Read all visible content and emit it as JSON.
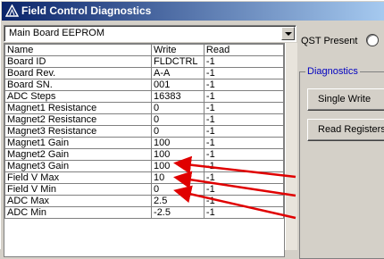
{
  "window": {
    "title": "Field Control Diagnostics"
  },
  "selector": {
    "value": "Main Board EEPROM"
  },
  "table": {
    "headers": [
      "Name",
      "Write",
      "Read"
    ],
    "rows": [
      [
        "Board ID",
        "FLDCTRL",
        "-1"
      ],
      [
        "Board Rev.",
        "A-A",
        "-1"
      ],
      [
        "Board SN.",
        "001",
        "-1"
      ],
      [
        "ADC Steps",
        "16383",
        "-1"
      ],
      [
        "Magnet1 Resistance",
        "0",
        "-1"
      ],
      [
        "Magnet2 Resistance",
        "0",
        "-1"
      ],
      [
        "Magnet3 Resistance",
        "0",
        "-1"
      ],
      [
        "Magnet1 Gain",
        "100",
        "-1"
      ],
      [
        "Magnet2 Gain",
        "100",
        "-1"
      ],
      [
        "Magnet3 Gain",
        "100",
        "-1"
      ],
      [
        "Field V Max",
        "10",
        "-1"
      ],
      [
        "Field V Min",
        "0",
        "-1"
      ],
      [
        "ADC Max",
        "2.5",
        "-1"
      ],
      [
        "ADC Min",
        "-2.5",
        "-1"
      ]
    ]
  },
  "status": {
    "qst_label": "QST Present"
  },
  "diagnostics": {
    "group_label": "Diagnostics",
    "single_write_label": "Single Write",
    "read_registers_label": "Read Registers"
  },
  "colors": {
    "annotation_arrow": "#e00000",
    "group_label": "#0000c0",
    "title_bar": "#0a246a"
  },
  "icons": {
    "title_icon": "warning-triangle-icon",
    "combo_button": "chevron-down-icon"
  }
}
